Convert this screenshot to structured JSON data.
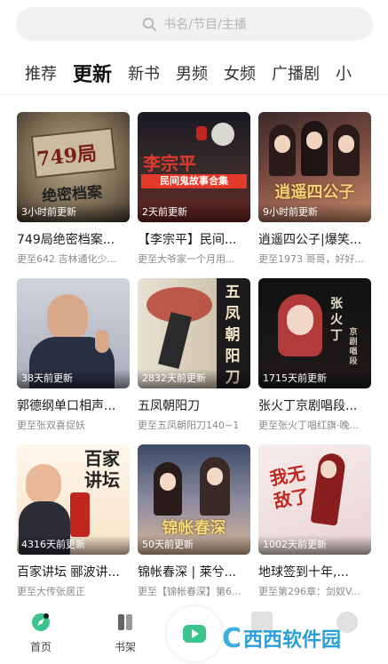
{
  "search": {
    "placeholder": "书名/节目/主播"
  },
  "tabs": [
    "推荐",
    "更新",
    "新书",
    "男频",
    "女频",
    "广播剧",
    "小"
  ],
  "active_tab": "更新",
  "books": [
    {
      "cover_text": "749局 绝密档案",
      "updated": "3小时前更新",
      "title": "749局绝密档案...",
      "sub": "更至642 吉林通化少..."
    },
    {
      "cover_text": "李宗平 民间鬼故事合集",
      "updated": "2天前更新",
      "title": "【李宗平】民间...",
      "sub": "更至大爷家一个月用..."
    },
    {
      "cover_text": "逍遥四公子",
      "updated": "9小时前更新",
      "title": "逍遥四公子|爆笑...",
      "sub": "更至1973 哥哥，好好..."
    },
    {
      "cover_text": "",
      "updated": "38天前更新",
      "title": "郭德纲单口相声...",
      "sub": "更至张双喜捉妖"
    },
    {
      "cover_text": "五凤朝阳刀",
      "updated": "2832天前更新",
      "title": "五凤朝阳刀",
      "sub": "更至五凤朝阳刀140~1"
    },
    {
      "cover_text": "张火丁 京剧唱段",
      "updated": "1715天前更新",
      "title": "张火丁京剧唱段...",
      "sub": "更至张火丁唱红旗·晚..."
    },
    {
      "cover_text": "百家讲坛 郦波讲张居正",
      "updated": "4316天前更新",
      "title": "百家讲坛 郦波讲...",
      "sub": "更至大传张居正"
    },
    {
      "cover_text": "锦帐春深",
      "updated": "50天前更新",
      "title": "锦帐春深 | 莱兮...",
      "sub": "更至【锦帐春深】第6..."
    },
    {
      "cover_text": "我无敌了",
      "updated": "1002天前更新",
      "title": "地球签到十年,...",
      "sub": "更至第296章：剑奴V..."
    }
  ],
  "nav": {
    "home": "首页",
    "shelf": "书架"
  },
  "watermark": {
    "logo": "C",
    "text": "西西软件园"
  },
  "colors": {
    "accent_green": "#3cc48e",
    "nav_active": "#222222"
  }
}
